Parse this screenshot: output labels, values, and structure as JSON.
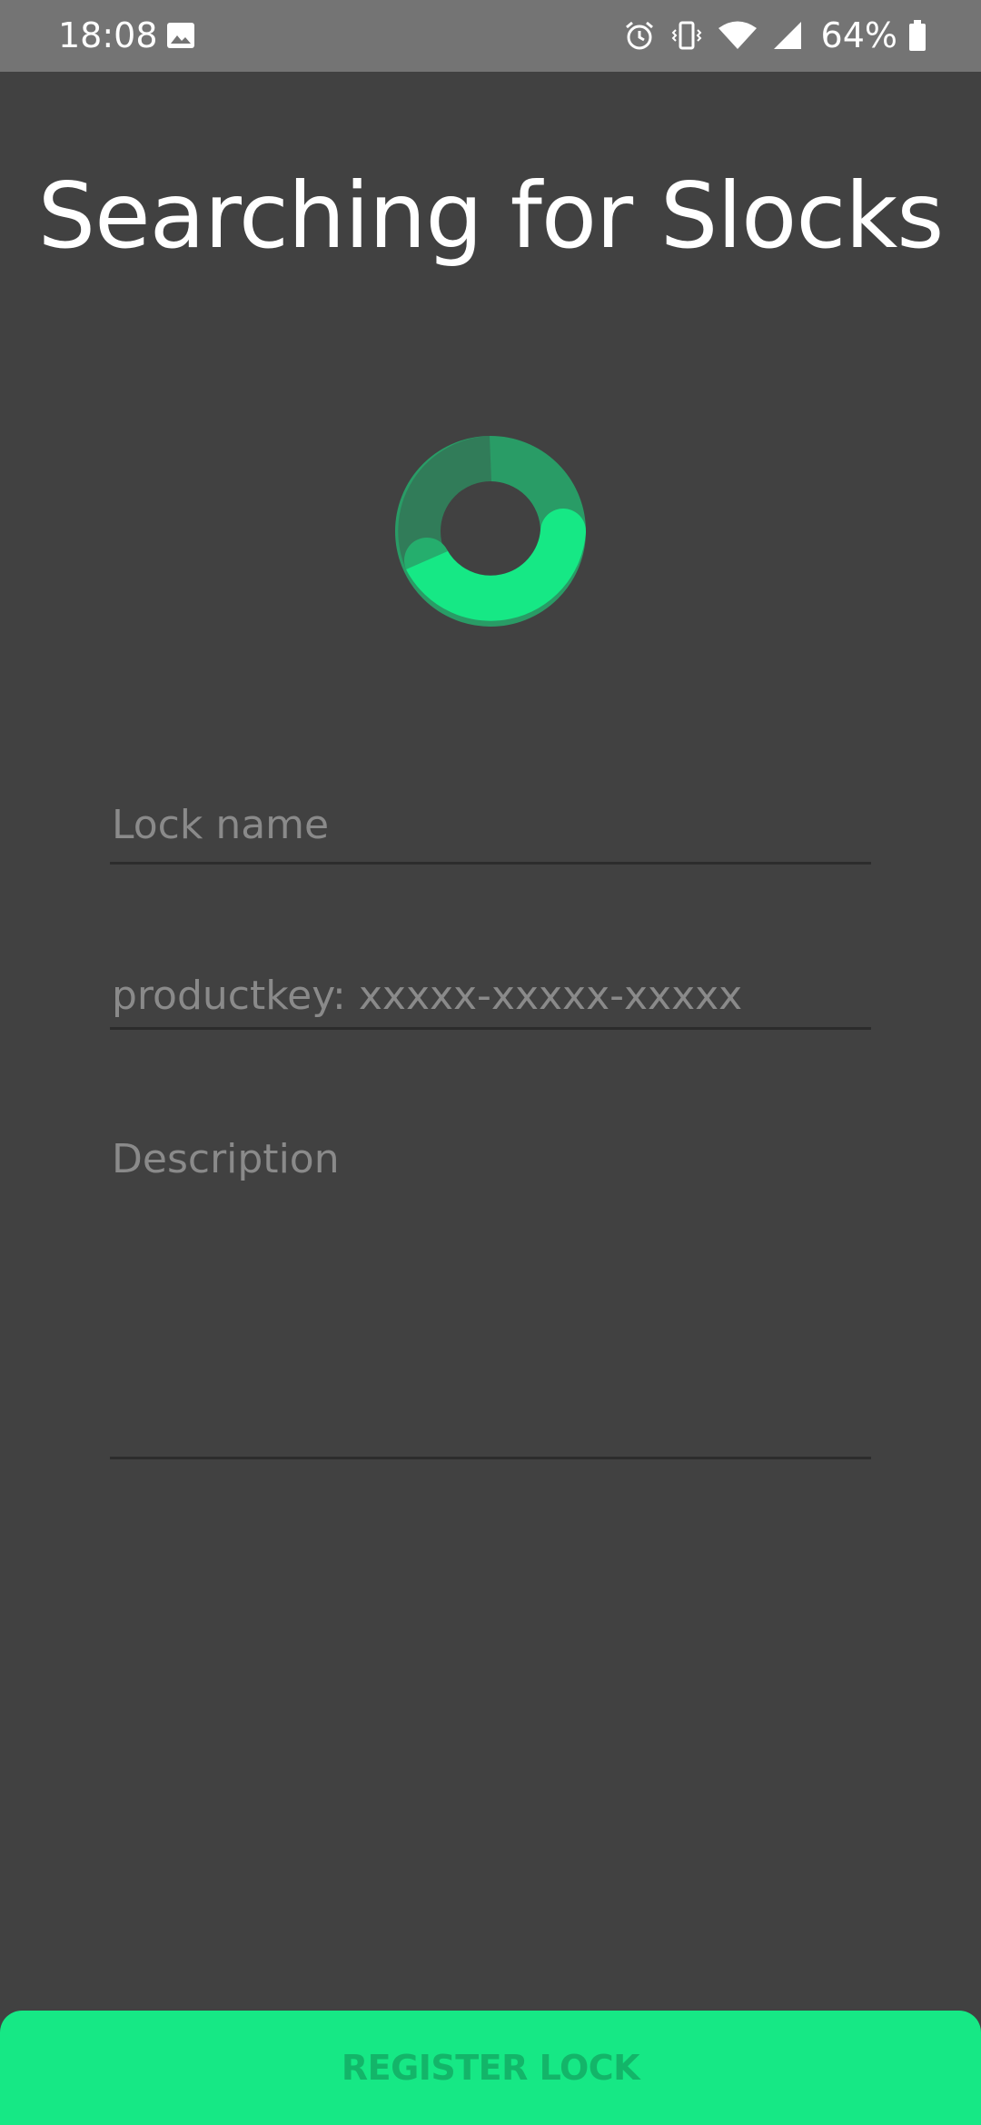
{
  "status_bar": {
    "time": "18:08",
    "battery_percent": "64%",
    "icons": [
      "image-icon",
      "alarm-icon",
      "vibrate-icon",
      "wifi-icon",
      "signal-icon",
      "battery-icon"
    ]
  },
  "screen": {
    "title": "Searching for Slocks"
  },
  "spinner": {
    "icon": "loading-spinner-icon",
    "color": "#16e885"
  },
  "form": {
    "lock_name": {
      "value": "",
      "placeholder": "Lock name"
    },
    "product_key": {
      "value": "",
      "placeholder": "productkey: xxxxx-xxxxx-xxxxx"
    },
    "description": {
      "value": "",
      "placeholder": "Description"
    }
  },
  "actions": {
    "register_label": "REGISTER LOCK"
  },
  "colors": {
    "background": "#414141",
    "status_bar": "#747474",
    "accent": "#16e885",
    "button_text": "#13b569",
    "placeholder": "#8a8a8a"
  }
}
